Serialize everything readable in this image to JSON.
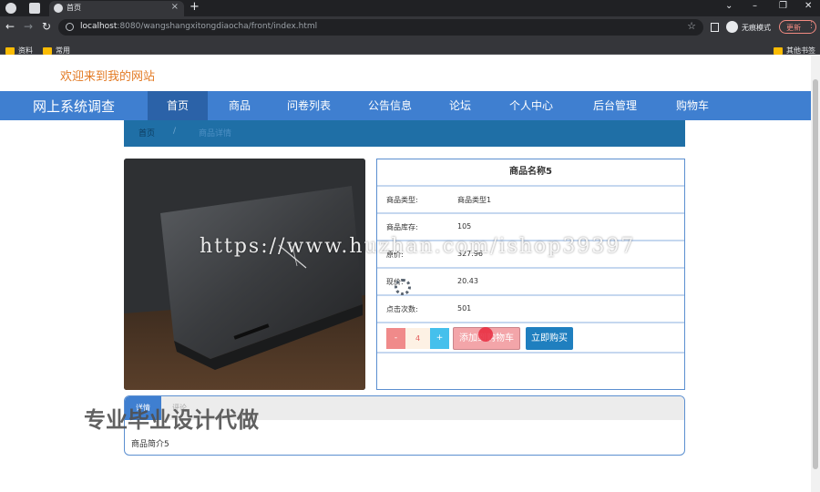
{
  "browser": {
    "tab_title": "首页",
    "url_host": "localhost",
    "url_rest": ":8080/wangshangxitongdiaocha/front/index.html",
    "incognito_label": "无痕模式",
    "update_label": "更新",
    "bookmarks": [
      "资料",
      "常用"
    ],
    "other_bookmarks": "其他书签"
  },
  "site": {
    "welcome": "欢迎来到我的网站",
    "title": "网上系统调查",
    "nav": [
      "首页",
      "商品",
      "问卷列表",
      "公告信息",
      "论坛",
      "个人中心",
      "后台管理",
      "购物车"
    ],
    "active_nav_index": 0
  },
  "breadcrumb": {
    "home": "首页",
    "separator": "/",
    "current": "商品详情"
  },
  "product": {
    "name": "商品名称5",
    "rows": [
      {
        "label": "商品类型:",
        "value": "商品类型1"
      },
      {
        "label": "商品库存:",
        "value": "105"
      },
      {
        "label": "原价:",
        "value": "327.96"
      },
      {
        "label": "现价:",
        "value": "20.43"
      },
      {
        "label": "点击次数:",
        "value": "501"
      }
    ],
    "quantity": "4",
    "minus": "-",
    "plus": "+",
    "add_to_cart": "添加到购物车",
    "buy_now": "立即购买"
  },
  "details": {
    "tabs": [
      "详情",
      "评论"
    ],
    "text": "商品简介5"
  },
  "overlays": {
    "url_watermark": "https://www.huzhan.com/ishop39397",
    "ad_watermark": "专业毕业设计代做"
  },
  "colors": {
    "nav_bg": "#3f7fd0",
    "nav_active": "#2b62a8",
    "welcome": "#e37b25",
    "cart_button": "#f3a5a9",
    "buy_button": "#1f7fbf"
  }
}
